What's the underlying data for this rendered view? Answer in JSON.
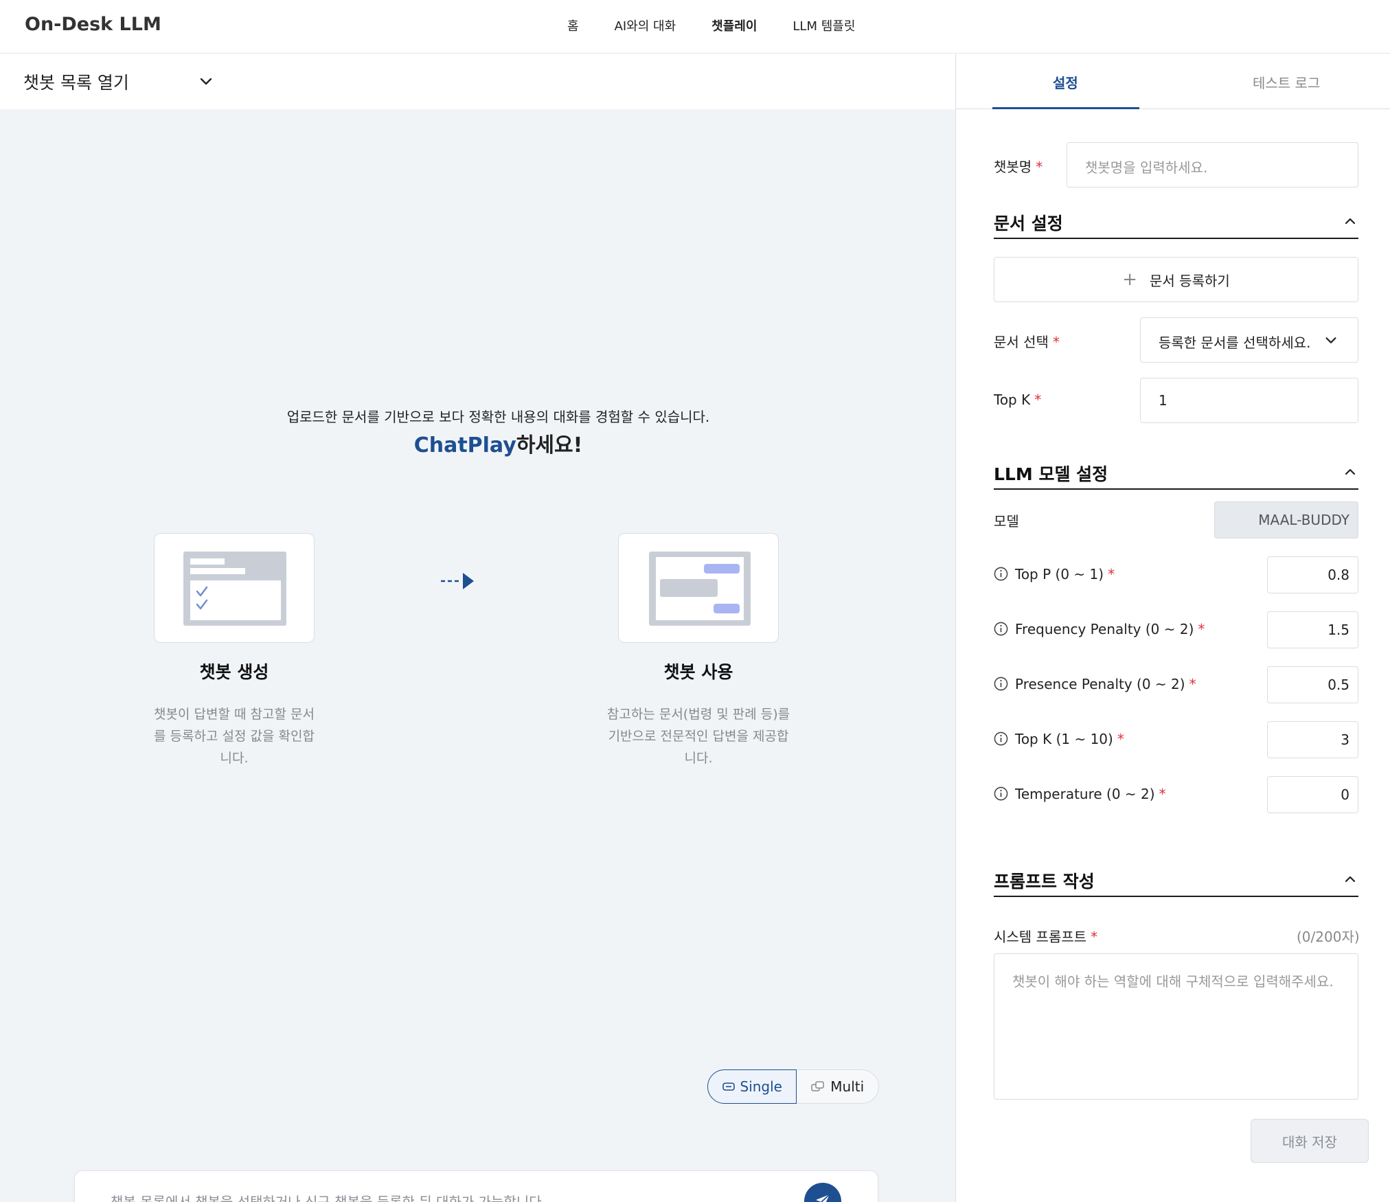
{
  "app": {
    "brand": "On-Desk LLM"
  },
  "nav": {
    "items": [
      {
        "label": "홈",
        "active": false
      },
      {
        "label": "AI와의 대화",
        "active": false
      },
      {
        "label": "챗플레이",
        "active": true
      },
      {
        "label": "LLM 템플릿",
        "active": false
      }
    ]
  },
  "left": {
    "bot_list_label": "챗봇 목록 열기",
    "intro_subtitle": "업로드한 문서를 기반으로 보다 정확한 내용의 대화를 경험할 수 있습니다.",
    "intro_title_accent": "ChatPlay",
    "intro_title_rest": "하세요!",
    "steps": [
      {
        "title": "챗봇 생성",
        "desc_lines": [
          "챗봇이 답변할 때 참고할 문서",
          "를 등록하고 설정 값을 확인합",
          "니다."
        ]
      },
      {
        "title": "챗봇 사용",
        "desc_lines": [
          "참고하는 문서(법령 및 판례 등)를",
          "기반으로 전문적인 답변을 제공합",
          "니다."
        ]
      }
    ],
    "mode": {
      "single": "Single",
      "multi": "Multi",
      "selected": "Single"
    },
    "chat_placeholder": "챗봇 목록에서 챗봇을 선택하거나 신규 챗봇을 등록한 뒤 대화가 가능합니다."
  },
  "right": {
    "tabs": [
      {
        "label": "설정",
        "active": true
      },
      {
        "label": "테스트 로그",
        "active": false
      }
    ],
    "bot_name": {
      "label": "챗봇명",
      "required": "*",
      "placeholder": "챗봇명을 입력하세요."
    },
    "doc_section": {
      "title": "문서 설정",
      "register_label": "문서 등록하기",
      "select_label": "문서 선택",
      "select_value": "등록한 문서를 선택하세요.",
      "topk_label": "Top K",
      "topk_value": "1"
    },
    "llm_section": {
      "title": "LLM 모델 설정",
      "model_label": "모델",
      "model_value": "MAAL-BUDDY",
      "params": [
        {
          "label": "Top P (0 ~ 1)",
          "value": "0.8"
        },
        {
          "label": "Frequency Penalty (0 ~ 2)",
          "value": "1.5"
        },
        {
          "label": "Presence Penalty (0 ~ 2)",
          "value": "0.5"
        },
        {
          "label": "Top K (1 ~ 10)",
          "value": "3"
        },
        {
          "label": "Temperature (0 ~ 2)",
          "value": "0"
        }
      ]
    },
    "prompt_section": {
      "title": "프롬프트 작성",
      "system_label": "시스템 프롬프트",
      "counter": "(0/200자)",
      "placeholder": "챗봇이 해야 하는 역할에 대해 구체적으로 입력해주세요."
    },
    "save_label": "대화 저장"
  },
  "colors": {
    "accent": "#1d4f91",
    "required": "#e0313b",
    "background": "#f1f4f7"
  }
}
